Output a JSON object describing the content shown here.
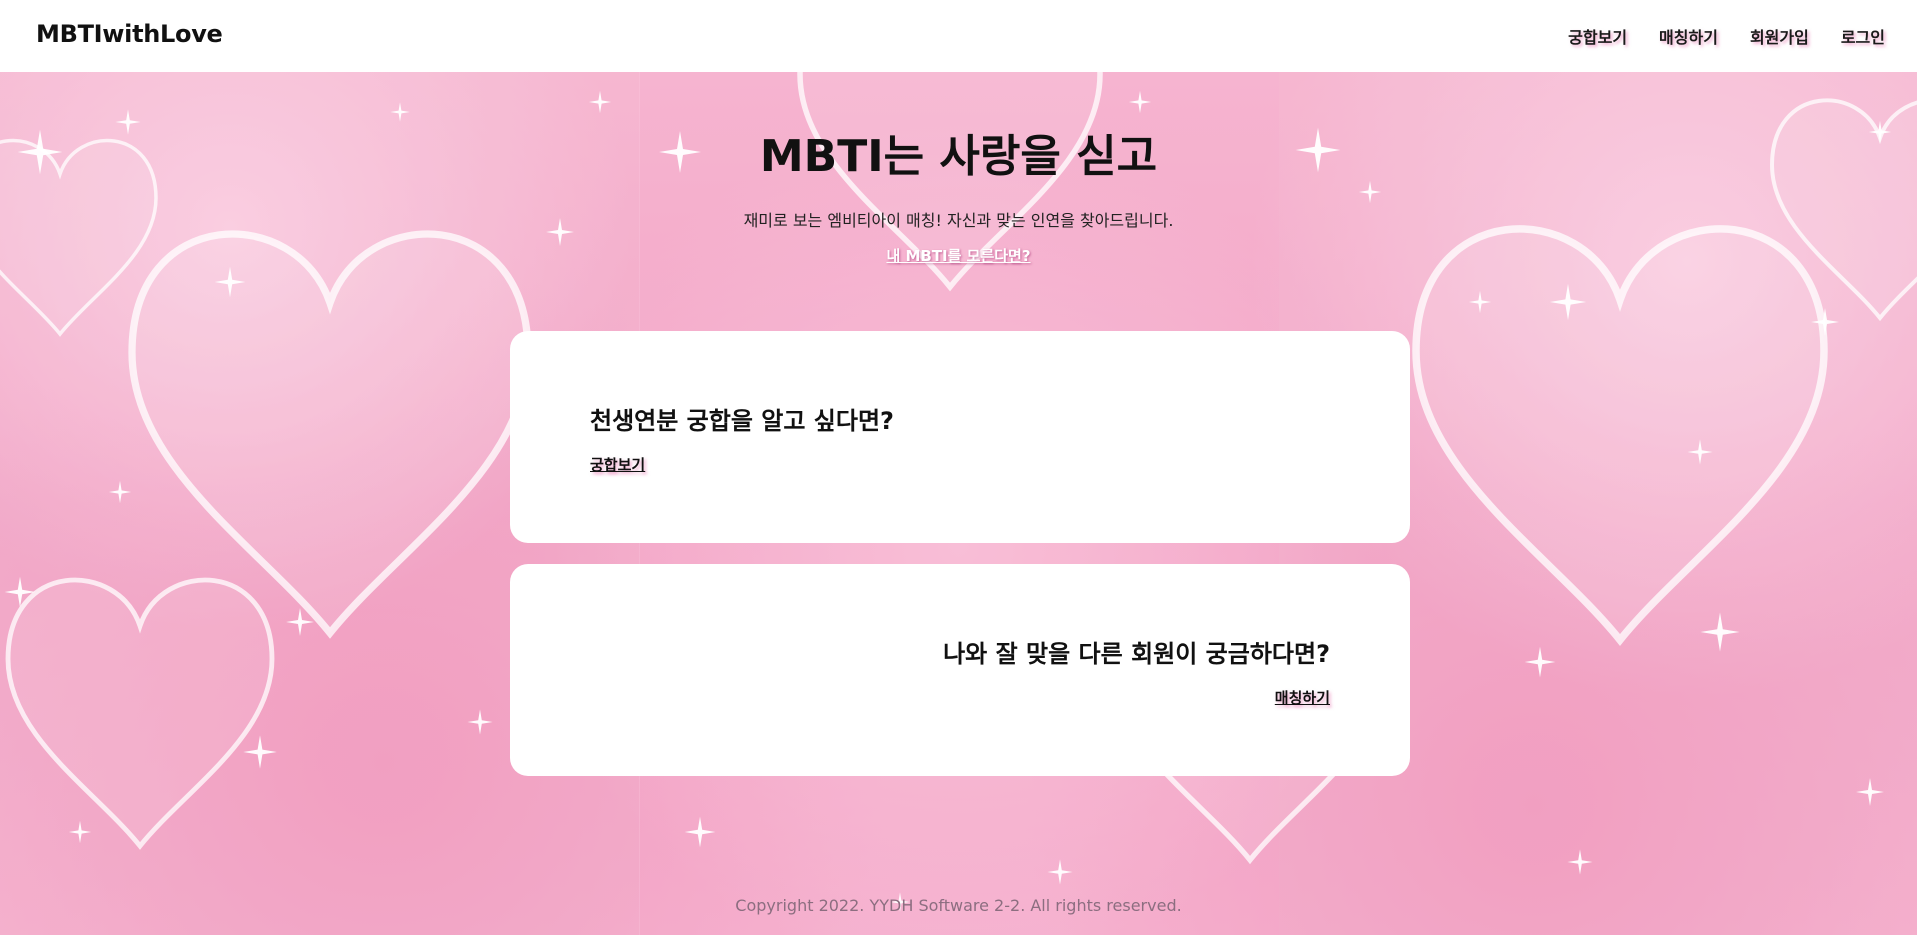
{
  "header": {
    "brand": "MBTIwithLove",
    "nav": [
      "궁합보기",
      "매칭하기",
      "회원가입",
      "로그인"
    ]
  },
  "hero": {
    "title": "MBTI는 사랑을 싣고",
    "subtitle": "재미로 보는 엠비티아이 매칭! 자신과 맞는 인연을 찾아드립니다.",
    "link": "내 MBTI를 모른다면?"
  },
  "cards": [
    {
      "title": "천생연분 궁합을 알고 싶다면?",
      "link": "궁합보기"
    },
    {
      "title": "나와 잘 맞을 다른 회원이 궁금하다면?",
      "link": "매칭하기"
    }
  ],
  "footer": {
    "text": "Copyright 2022. YYDH Software 2-2. All rights reserved."
  },
  "colors": {
    "background": "#f3a9c8",
    "header_bg": "#ffffff",
    "card_bg": "#ffffff",
    "link_shadow": "#e15aa0"
  },
  "icons": {
    "background": "heart-bubbles-sparkles"
  }
}
